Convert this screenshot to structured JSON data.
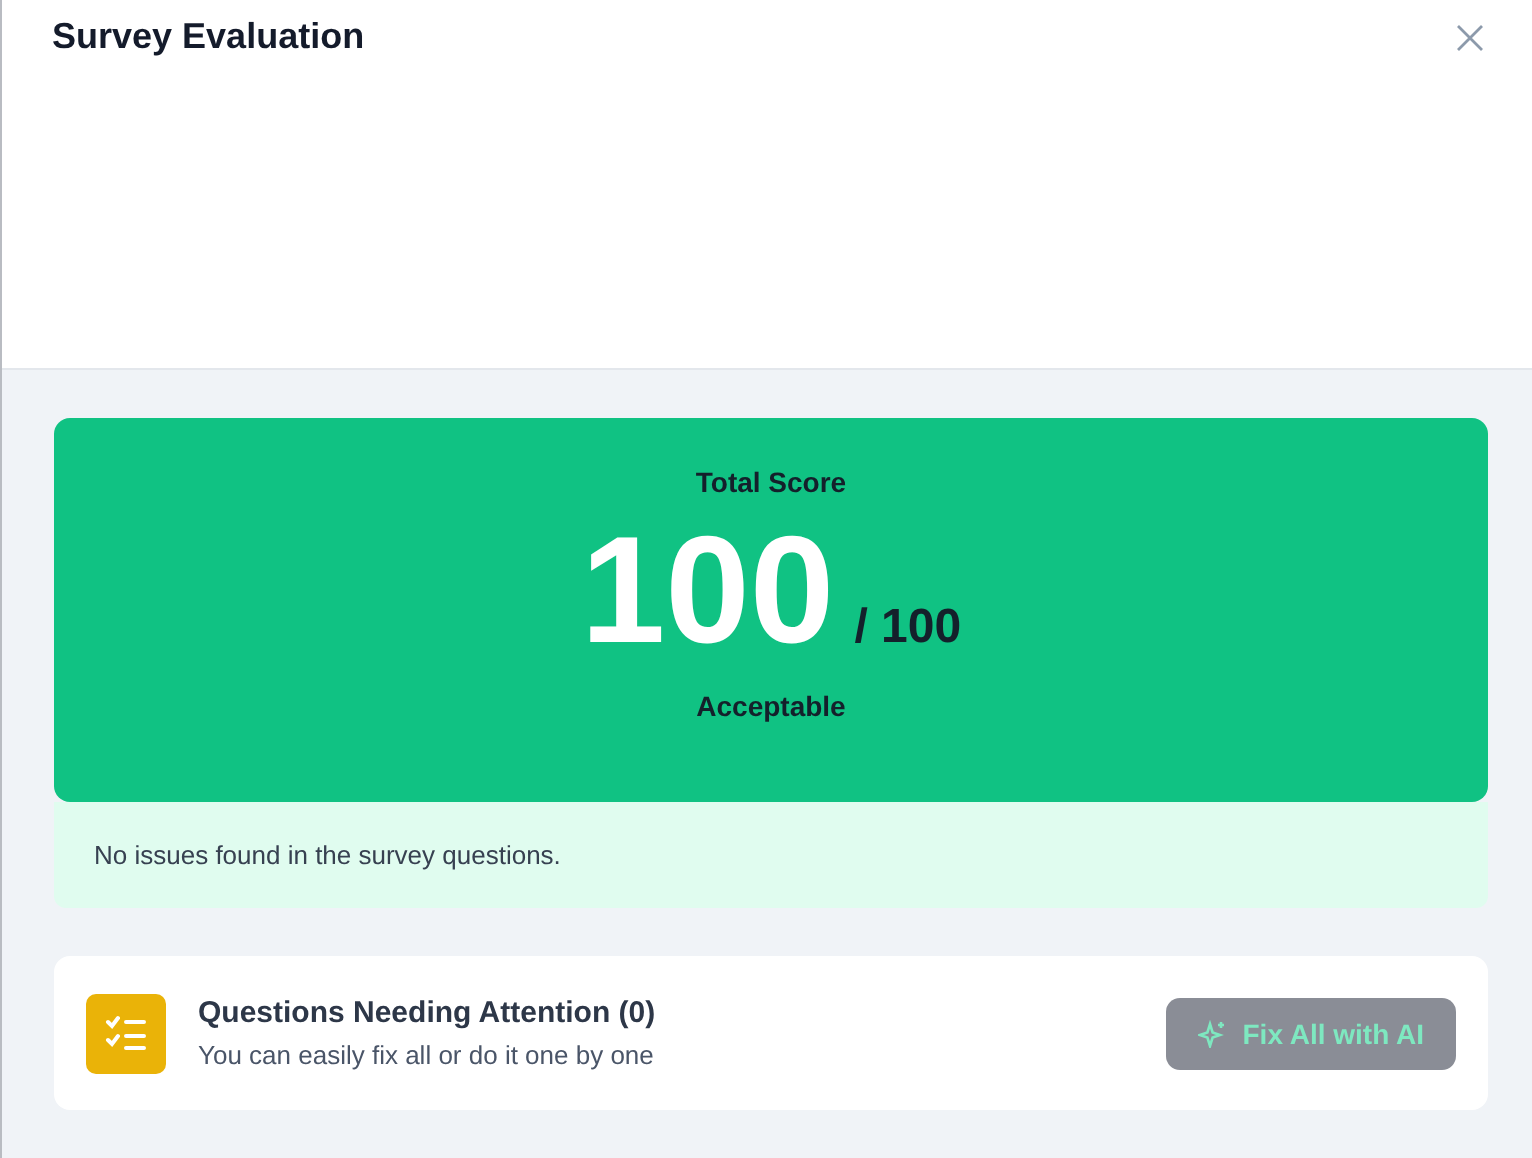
{
  "dialog": {
    "title": "Survey Evaluation"
  },
  "score": {
    "label": "Total Score",
    "value": "100",
    "max": "/ 100",
    "verdict": "Acceptable"
  },
  "notice": "No issues found in the survey questions.",
  "attention": {
    "title": "Questions Needing Attention (0)",
    "subtitle": "You can easily fix all or do it one by one",
    "button": {
      "label": "Fix All with AI",
      "disabled": true
    }
  }
}
